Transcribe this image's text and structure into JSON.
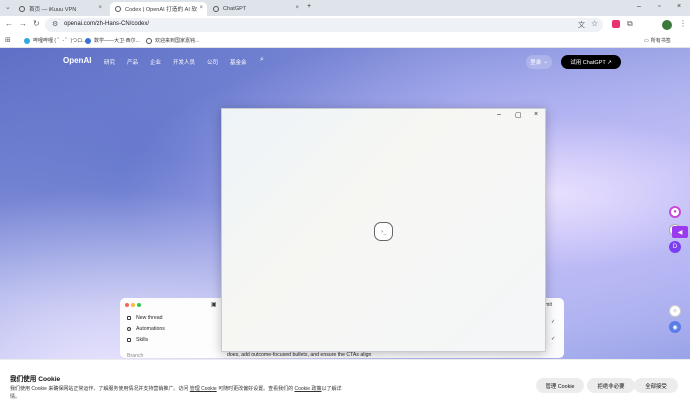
{
  "tabs": [
    {
      "title": "首页 — iKuuu VPN"
    },
    {
      "title": "Codex | OpenAI 打造的 AI 软"
    },
    {
      "title": "ChatGPT"
    }
  ],
  "omnibox": {
    "url": "openai.com/zh-Hans-CN/codex/"
  },
  "bookmarks": [
    {
      "label": "哔哩哔哩 ( ゜- ゜)つロ..."
    },
    {
      "label": "数学——大卫·西尔..."
    },
    {
      "label": "欢迎来到国家嘉钝..."
    }
  ],
  "bookmarks_all": "所有书签",
  "site": {
    "logo": "OpenAI",
    "nav": [
      "研究",
      "产品",
      "企业",
      "开发人员",
      "公司",
      "基金会"
    ],
    "login": "登录",
    "try_label": "试用 ChatGPT ↗"
  },
  "preview": {
    "items": [
      "New thread",
      "Automations",
      "Skills"
    ],
    "section": "Branch",
    "commit": "mit",
    "body_text": "does, add outcome-focused bullets, and ensure the CTAs align"
  },
  "popup": {
    "icon_label": "›_"
  },
  "cookie": {
    "title": "我们使用 Cookie",
    "text_1": "我们使用 Cookie 来确保网站正常运作、了解服务使用情况并支持营销推广。访问 ",
    "link_1": "管理 Cookie",
    "text_2": " 可随时更改偏好设置。查看我们的 ",
    "link_2": "Cookie 政策",
    "text_3": "以了解详情。",
    "manage": "管理 Cookie",
    "reject": "拒绝非必要",
    "accept": "全部接受"
  },
  "colors": {
    "accent": "#000000",
    "tab_strip": "#dfe3ea",
    "extension_purple": "#9b3bf0"
  }
}
